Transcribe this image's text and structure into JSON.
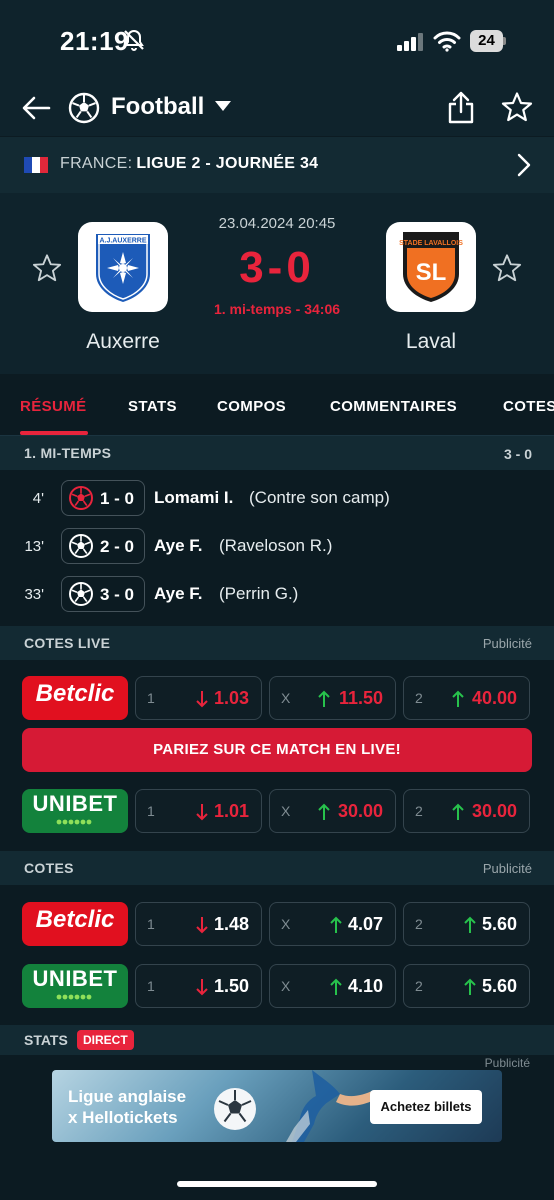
{
  "status_bar": {
    "time": "21:19",
    "battery": "24"
  },
  "header": {
    "sport": "Football"
  },
  "league": {
    "country": "FRANCE:",
    "competition": "LIGUE 2 - JOURNÉE 34"
  },
  "match": {
    "date": "23.04.2024 20:45",
    "score": "3-0",
    "status": "1. mi-temps - 34:06",
    "home": {
      "name": "Auxerre",
      "logo_text": "A.J.AUXERRE"
    },
    "away": {
      "name": "Laval",
      "logo_text": "STADE LAVALLOIS",
      "logo_initials": "SL"
    }
  },
  "tabs": [
    "RÉSUMÉ",
    "STATS",
    "COMPOS",
    "COMMENTAIRES",
    "COTES"
  ],
  "summary": {
    "period_label": "1. MI-TEMPS",
    "period_score": "3 - 0",
    "events": [
      {
        "minute": "4'",
        "score": "1 - 0",
        "player": "Lomami I.",
        "extra": "(Contre son camp)",
        "own_goal": true
      },
      {
        "minute": "13'",
        "score": "2 - 0",
        "player": "Aye F.",
        "extra": "(Raveloson R.)",
        "own_goal": false
      },
      {
        "minute": "33'",
        "score": "3 - 0",
        "player": "Aye F.",
        "extra": "(Perrin G.)",
        "own_goal": false
      }
    ]
  },
  "live_odds": {
    "title": "COTES LIVE",
    "ad_label": "Publicité",
    "cta": "PARIEZ SUR CE MATCH EN LIVE!",
    "rows": [
      {
        "bookmaker": "Betclic",
        "odds": [
          {
            "key": "1",
            "value": "1.03",
            "trend": "down"
          },
          {
            "key": "X",
            "value": "11.50",
            "trend": "up"
          },
          {
            "key": "2",
            "value": "40.00",
            "trend": "up"
          }
        ]
      },
      {
        "bookmaker": "UNIBET",
        "odds": [
          {
            "key": "1",
            "value": "1.01",
            "trend": "down"
          },
          {
            "key": "X",
            "value": "30.00",
            "trend": "up"
          },
          {
            "key": "2",
            "value": "30.00",
            "trend": "up"
          }
        ]
      }
    ]
  },
  "odds": {
    "title": "COTES",
    "ad_label": "Publicité",
    "rows": [
      {
        "bookmaker": "Betclic",
        "odds": [
          {
            "key": "1",
            "value": "1.48",
            "trend": "down"
          },
          {
            "key": "X",
            "value": "4.07",
            "trend": "up"
          },
          {
            "key": "2",
            "value": "5.60",
            "trend": "up"
          }
        ]
      },
      {
        "bookmaker": "UNIBET",
        "odds": [
          {
            "key": "1",
            "value": "1.50",
            "trend": "down"
          },
          {
            "key": "X",
            "value": "4.10",
            "trend": "up"
          },
          {
            "key": "2",
            "value": "5.60",
            "trend": "up"
          }
        ]
      }
    ]
  },
  "stats": {
    "title": "STATS",
    "badge": "DIRECT",
    "ad_label": "Publicité"
  },
  "ad": {
    "line1": "Ligue anglaise",
    "line2": "x Hellotickets",
    "button": "Achetez billets"
  },
  "colors": {
    "accent_red": "#e8243c",
    "up_green": "#27c24c",
    "down_red": "#e8243c",
    "betclic": "#e1101f",
    "unibet": "#13823c"
  }
}
